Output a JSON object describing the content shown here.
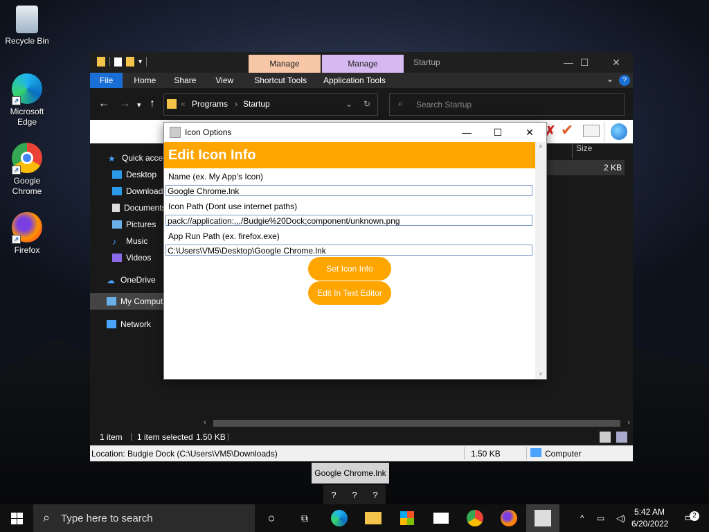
{
  "desktop": {
    "icons": [
      {
        "label": "Recycle Bin"
      },
      {
        "label": "Microsoft Edge"
      },
      {
        "label": "Google Chrome"
      },
      {
        "label": "Firefox"
      }
    ]
  },
  "explorer": {
    "context_tabs": [
      "Manage",
      "Manage"
    ],
    "window_title": "Startup",
    "ribbon_tabs": [
      "File",
      "Home",
      "Share",
      "View",
      "Shortcut Tools",
      "Application Tools"
    ],
    "address": {
      "part1": "Programs",
      "sep": "›",
      "part2": "Startup"
    },
    "search_placeholder": "Search Startup",
    "column_size": "Size",
    "file_size": "2 KB",
    "sidebar": [
      "Quick access",
      "Desktop",
      "Downloads",
      "Documents",
      "Pictures",
      "Music",
      "Videos",
      "OneDrive",
      "My Computer",
      "Network"
    ],
    "status": {
      "items": "1 item",
      "selected": "1 item selected",
      "size": "1.50 KB"
    },
    "location_bar": {
      "location": "Location: Budgie Dock (C:\\Users\\VM5\\Downloads)",
      "size": "1.50 KB",
      "computer": "Computer"
    }
  },
  "dialog": {
    "title": "Icon Options",
    "header": "Edit Icon Info",
    "name_label": "Name (ex. My App's Icon)",
    "name_value": "Google Chrome.lnk",
    "icon_path_label": "Icon Path (Dont use internet paths)",
    "icon_path_value": "pack://application:,,,/Budgie%20Dock;component/unknown.png",
    "run_path_label": "App Run Path (ex. firefox.exe)",
    "run_path_value": "C:\\Users\\VM5\\Desktop\\Google Chrome.lnk",
    "set_button": "Set Icon Info",
    "edit_button": "Edit In Text Editor"
  },
  "tooltip": "Google Chrome.lnk",
  "dock_buttons": [
    "?",
    "?",
    "?"
  ],
  "taskbar": {
    "search_placeholder": "Type here to search",
    "time": "5:42 AM",
    "date": "6/20/2022",
    "notifications": "2"
  },
  "colors": {
    "accent": "#ffa500",
    "file_tab": "#1a6fd6",
    "context_tab1": "#f8c7a8",
    "context_tab2": "#d7b9f2"
  }
}
